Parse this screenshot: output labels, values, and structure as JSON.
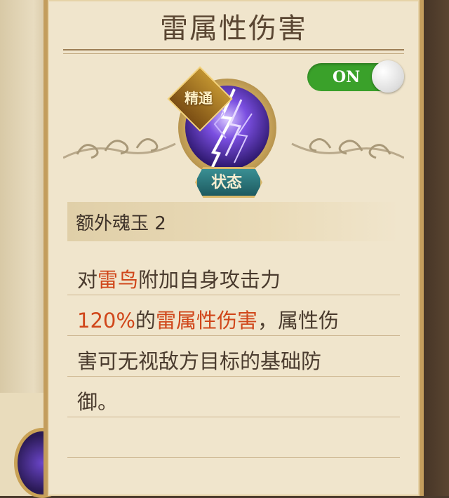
{
  "title": "雷属性伤害",
  "toggle": {
    "label": "ON",
    "state": "on"
  },
  "badges": {
    "top": "精通",
    "status": "状态"
  },
  "subtitle": "额外魂玉 2",
  "description": {
    "line1": [
      {
        "text": "对",
        "hl": false
      },
      {
        "text": "雷鸟",
        "hl": true
      },
      {
        "text": "附加自身攻击力",
        "hl": false
      }
    ],
    "line2": [
      {
        "text": "120%",
        "hl": true
      },
      {
        "text": "的",
        "hl": false
      },
      {
        "text": "雷属性伤害",
        "hl": true
      },
      {
        "text": "，属性伤",
        "hl": false
      }
    ],
    "line3": [
      {
        "text": "害可无视敌方目标的基础防",
        "hl": false
      }
    ],
    "line4": [
      {
        "text": "御。",
        "hl": false
      }
    ]
  },
  "colors": {
    "highlight": "#d0461a",
    "toggle_on": "#3aa12a",
    "text": "#4a3b2e",
    "panel": "#f0e5cc"
  },
  "icons": {
    "emblem": "lightning-skill-icon"
  }
}
